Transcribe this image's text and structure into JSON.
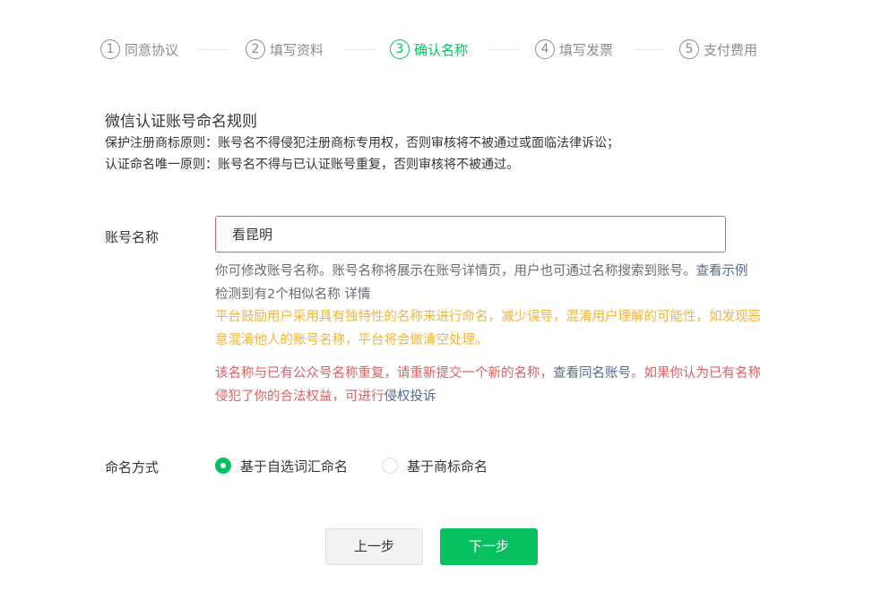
{
  "steps": [
    {
      "num": "1",
      "label": "同意协议",
      "active": false
    },
    {
      "num": "2",
      "label": "填写资料",
      "active": false
    },
    {
      "num": "3",
      "label": "确认名称",
      "active": true
    },
    {
      "num": "4",
      "label": "填写发票",
      "active": false
    },
    {
      "num": "5",
      "label": "支付费用",
      "active": false
    }
  ],
  "rules": {
    "title": "微信认证账号命名规则",
    "line1": "保护注册商标原则：账号名不得侵犯注册商标专用权，否则审核将不被通过或面临法律诉讼；",
    "line2": "认证命名唯一原则：账号名不得与已认证账号重复，否则审核将不被通过。"
  },
  "form": {
    "name_label": "账号名称",
    "name_value": "看昆明",
    "hint_modify": "你可修改账号名称。账号名称将展示在账号详情页，用户也可通过名称搜索到账号。",
    "hint_example_link": "查看示例",
    "hint_similar": "检测到有2个相似名称 ",
    "hint_similar_link": "详情",
    "hint_warning": "平台鼓励用户采用具有独特性的名称来进行命名，减少误导，混淆用户理解的可能性，如发现恶意混淆他人的账号名称，平台将会做清空处理。",
    "error_text": "该名称与已有公众号名称重复，请重新提交一个新的名称，",
    "error_link1": "查看同名账号",
    "error_text2": "。如果你认为已有名称侵犯了你的合法权益，可进行",
    "error_link2": "侵权投诉",
    "naming_label": "命名方式",
    "naming_options": [
      {
        "label": "基于自选词汇命名",
        "checked": true
      },
      {
        "label": "基于商标命名",
        "checked": false
      }
    ]
  },
  "buttons": {
    "prev": "上一步",
    "next": "下一步"
  },
  "colors": {
    "accent": "#07c160",
    "error": "#e15f5f",
    "warning": "#f3b43d",
    "link": "#576b95"
  }
}
